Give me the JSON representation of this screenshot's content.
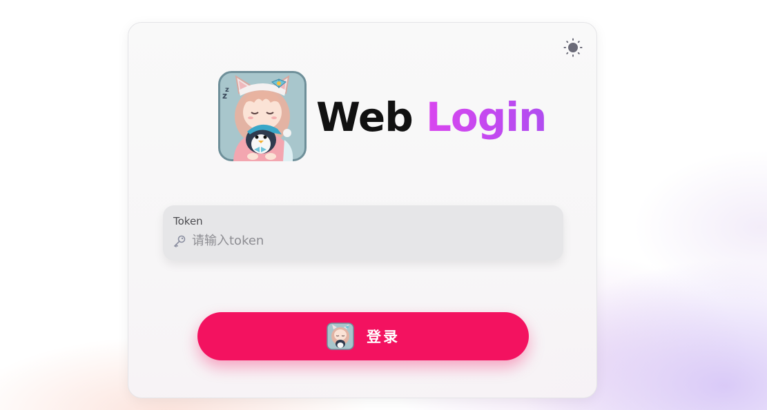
{
  "brand": {
    "title_part1": "Web",
    "title_part2": "Login",
    "logo_icon": "sleeping-cat-girl-penguin-avatar",
    "accent_color": "#c43ee8"
  },
  "theme_toggle": {
    "icon": "sun-icon"
  },
  "token_field": {
    "label": "Token",
    "placeholder": "请输入token",
    "value": "",
    "icon": "key-icon"
  },
  "login_button": {
    "label": "登录",
    "icon": "avatar-icon",
    "color": "#f31260"
  }
}
